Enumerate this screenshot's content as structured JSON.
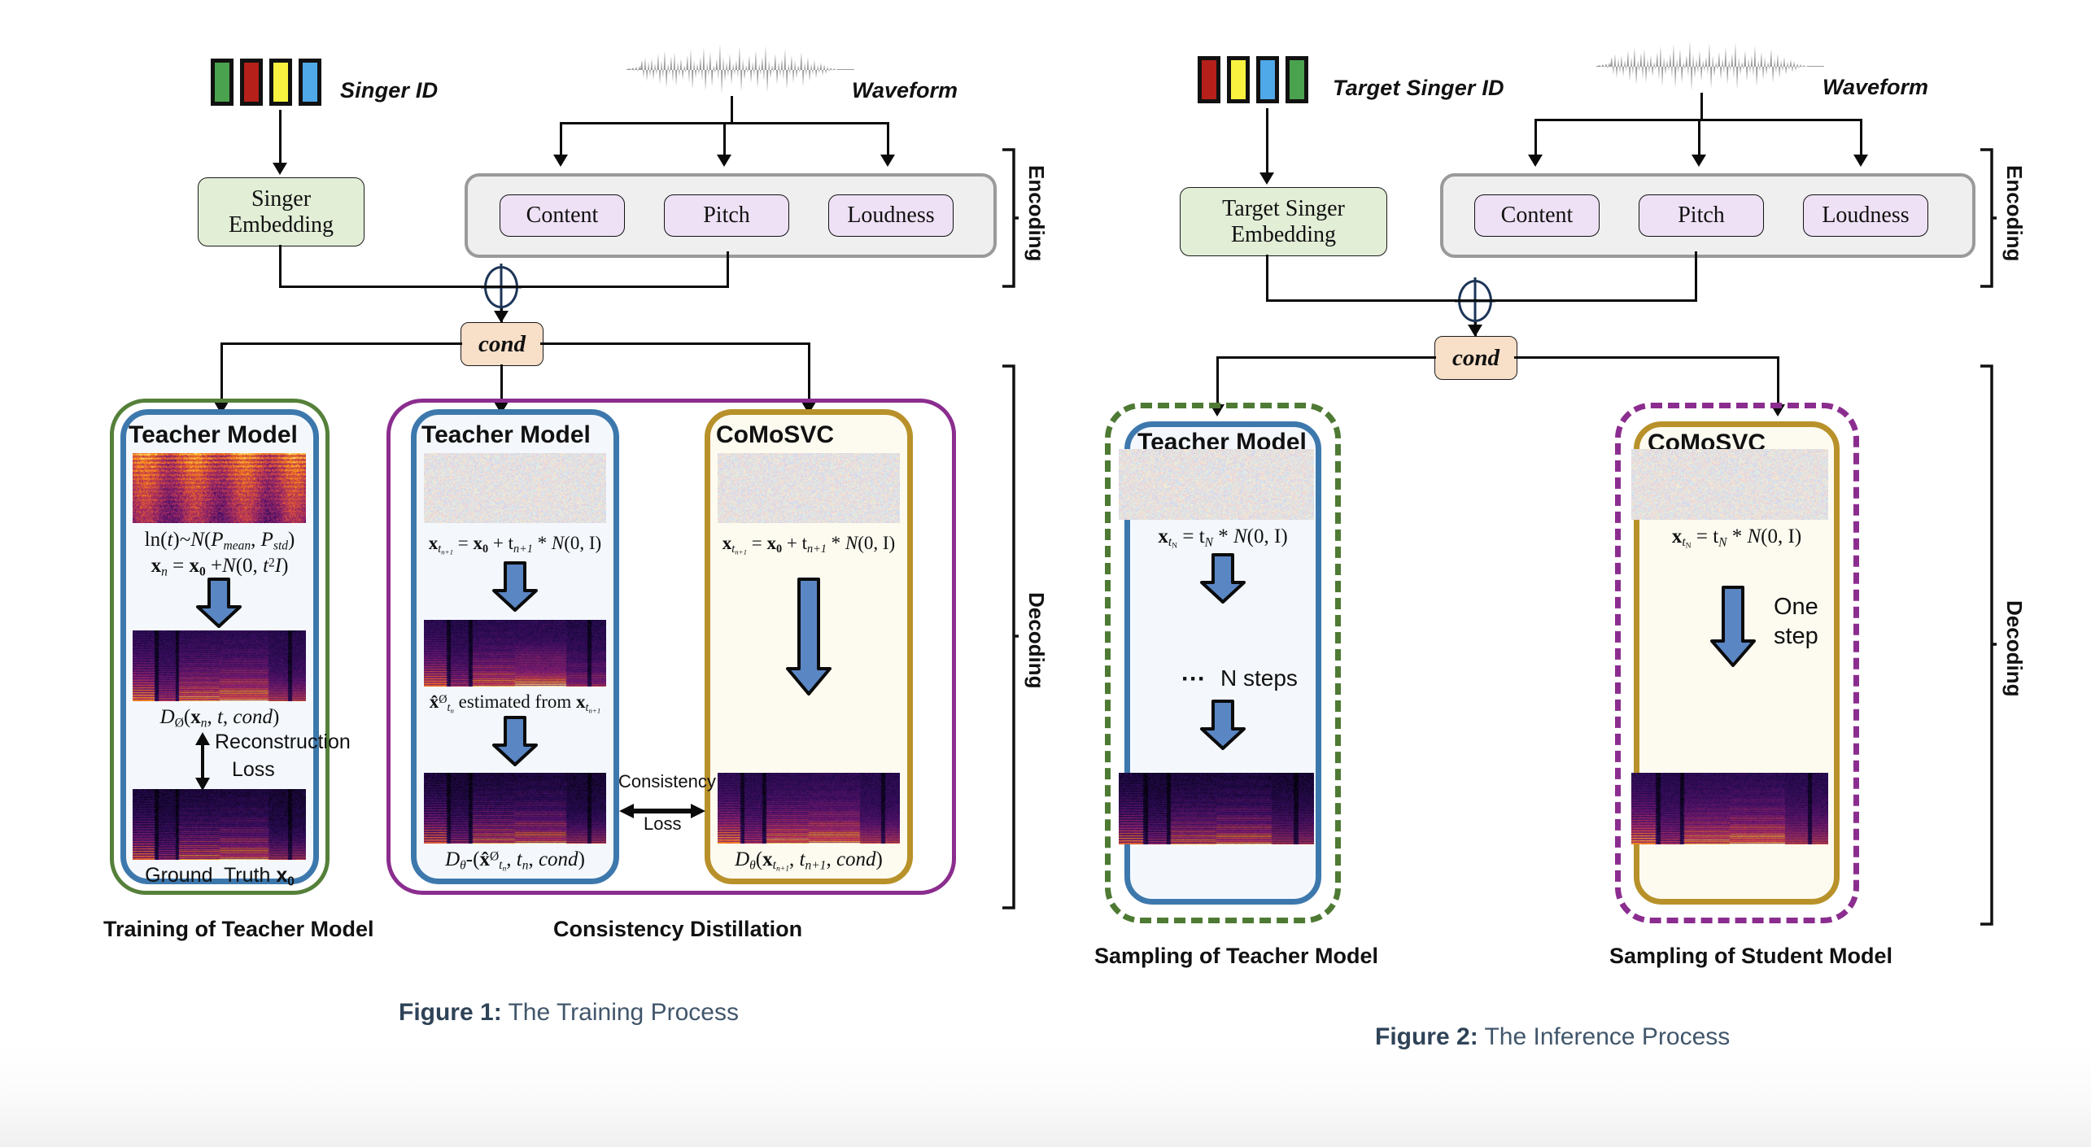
{
  "figure1": {
    "singer_id_label": "Singer ID",
    "singer_id_colors": [
      "#4ba24e",
      "#b5201a",
      "#f9f340",
      "#4fa8e8"
    ],
    "waveform_label": "Waveform",
    "embedding_box": "Singer\nEmbedding",
    "embedding_line1": "Singer",
    "embedding_line2": "Embedding",
    "features": [
      "Content",
      "Pitch",
      "Loudness"
    ],
    "cond_label": "cond",
    "encoding_bracket": "Encoding",
    "decoding_bracket": "Decoding",
    "card_a": {
      "title": "Teacher Model",
      "formula1": "ln(t)~N(P_mean, P_std)",
      "formula2": "x_n = x_0 + N(0, t^2 I)",
      "formula3": "D_Ø(x_n, t, cond)",
      "note_loss": "Reconstruction\nLoss",
      "note_loss_l1": "Reconstruction",
      "note_loss_l2": "Loss",
      "ground_truth": "Ground  Truth x_0"
    },
    "card_b": {
      "title": "Teacher Model",
      "formula1": "x_{t_{n+1}} = x_0 + t_{n+1} * N(0, I)",
      "formula2": "x̂^Ø_{t_n}  estimated from  x_{t_{n+1}}",
      "formula3": "D_θ-(x̂^Ø_{t_n}, t_n, cond)"
    },
    "card_c": {
      "title": "CoMoSVC",
      "formula1": "x_{t_{n+1}} = x_0 + t_{n+1} * N(0, I)",
      "formula3": "D_θ(x_{t_{n+1}}, t_{n+1}, cond)"
    },
    "consistency_loss_l1": "Consistency",
    "consistency_loss_l2": "Loss",
    "group_label_left": "Training of Teacher Model",
    "group_label_right": "Consistency Distillation",
    "caption_prefix": "Figure 1:",
    "caption_text": " The Training Process"
  },
  "figure2": {
    "singer_id_label": "Target Singer ID",
    "singer_id_colors": [
      "#b5201a",
      "#f9f340",
      "#4fa8e8",
      "#4ba24e"
    ],
    "waveform_label": "Waveform",
    "embedding_line1": "Target Singer",
    "embedding_line2": "Embedding",
    "features": [
      "Content",
      "Pitch",
      "Loudness"
    ],
    "cond_label": "cond",
    "encoding_bracket": "Encoding",
    "decoding_bracket": "Decoding",
    "card_a": {
      "title": "Teacher Model",
      "formula1": "x_{t_N} = t_N * N(0, I)",
      "steps_note": "N steps",
      "steps_dots": "···"
    },
    "card_b": {
      "title": "CoMoSVC",
      "formula1": "x_{t_N} = t_N * N(0, I)",
      "one_step_l1": "One",
      "one_step_l2": "step"
    },
    "group_label_left": "Sampling of Teacher Model",
    "group_label_right": "Sampling of Student Model",
    "caption_prefix": "Figure 2:",
    "caption_text": " The Inference Process"
  },
  "colors": {
    "teacher_border": "#3d78ad",
    "student_border": "#b8912a",
    "group_green": "#55803a",
    "group_purple": "#8b2d8f",
    "cond_fill": "#f8dfc8",
    "embed_fill": "#e2eed6",
    "feature_fill": "#eee1f5",
    "fat_arrow": "#5a86c4"
  }
}
